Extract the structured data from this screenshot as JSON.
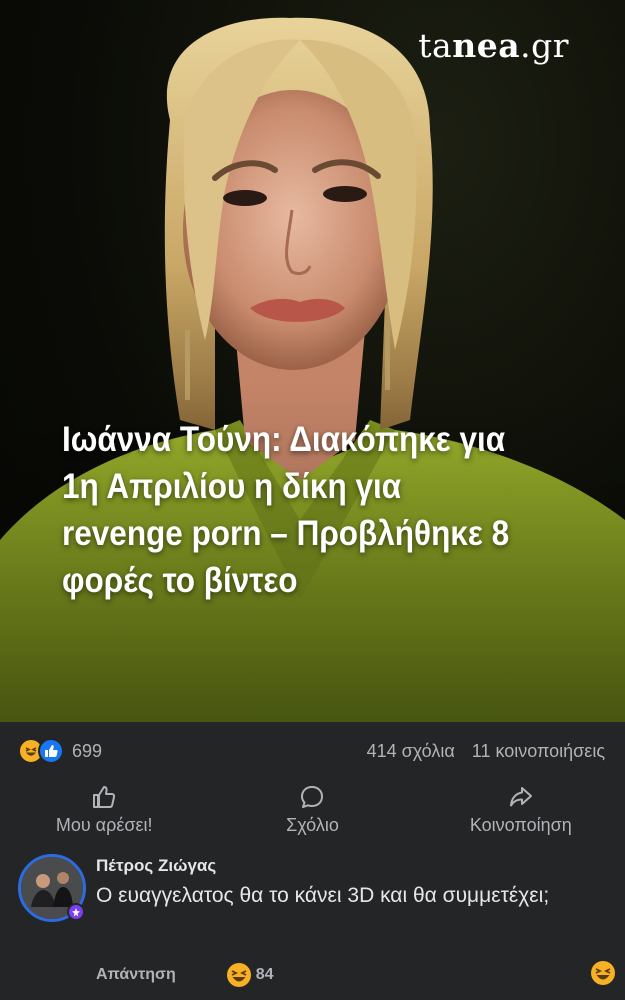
{
  "post": {
    "brand_prefix": "ta",
    "brand_bold": "nea",
    "brand_suffix": ".gr",
    "headline": "Ιωάννα Τούνη: Διακόπηκε για 1η Απριλίου η δίκη για revenge porn – Προβλήθηκε 8 φορές το βίντεο"
  },
  "stats": {
    "reaction_icons": [
      "haha-icon",
      "like-icon"
    ],
    "reactions_count": "699",
    "comments": "414 σχόλια",
    "shares": "11 κοινοποιήσεις"
  },
  "actions": {
    "like": "Μου αρέσει!",
    "comment": "Σχόλιο",
    "share": "Κοινοποίηση"
  },
  "comment": {
    "author": "Πέτρος Ζιώγας",
    "text": "Ο ευαγγελατος θα το κάνει 3D και θα συμμετέχει;",
    "reply": "Απάντηση",
    "reaction_count": "84"
  },
  "colors": {
    "background": "#242526",
    "like_blue": "#1877f2",
    "haha_yellow": "#f7b125",
    "avatar_ring": "#2d6cdf"
  }
}
